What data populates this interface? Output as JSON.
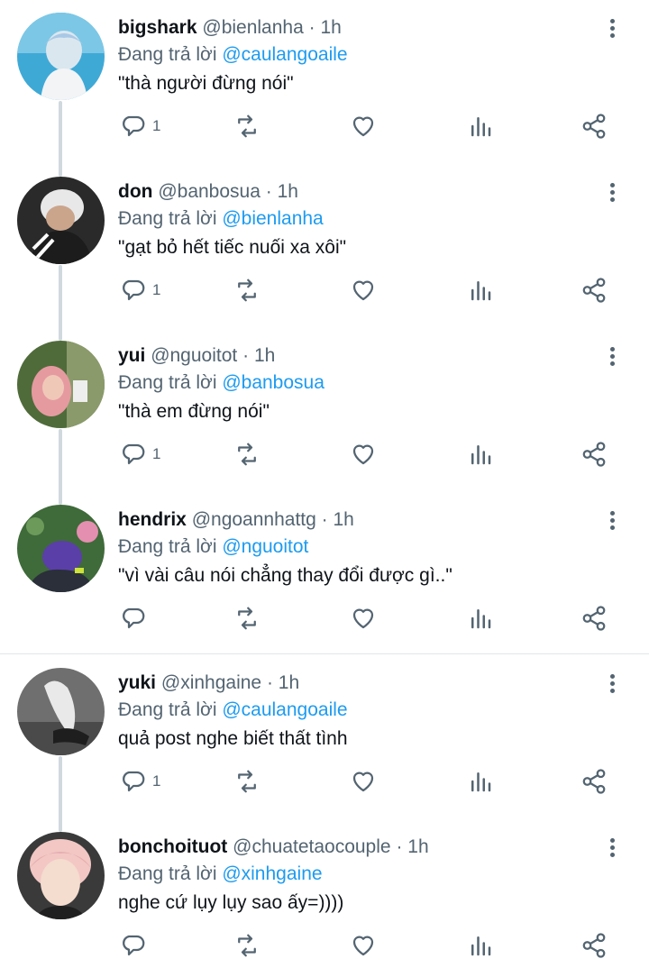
{
  "reply_prefix": "Đang trả lời",
  "tweets": [
    {
      "name": "bigshark",
      "handle": "@bienlanha",
      "dot": "·",
      "time": "1h",
      "mention": "@caulangoaile",
      "text": "\"thà người đừng nói\"",
      "reply_count": "1"
    },
    {
      "name": "don",
      "handle": "@banbosua",
      "dot": "·",
      "time": "1h",
      "mention": "@bienlanha",
      "text": "\"gạt bỏ hết tiếc nuối xa xôi\"",
      "reply_count": "1"
    },
    {
      "name": "yui",
      "handle": "@nguoitot",
      "dot": "·",
      "time": "1h",
      "mention": "@banbosua",
      "text": "\"thà em đừng nói\"",
      "reply_count": "1"
    },
    {
      "name": "hendrix",
      "handle": "@ngoannhattg",
      "dot": "·",
      "time": "1h",
      "mention": "@nguoitot",
      "text": "\"vì vài câu nói chẳng thay đổi được gì..\"",
      "reply_count": ""
    },
    {
      "name": "yuki",
      "handle": "@xinhgaine",
      "dot": "·",
      "time": "1h",
      "mention": "@caulangoaile",
      "text": "quả post nghe biết thất tình",
      "reply_count": "1"
    },
    {
      "name": "bonchoituot",
      "handle": "@chuatetaocouple",
      "dot": "·",
      "time": "1h",
      "mention": "@xinhgaine",
      "text": "nghe cứ lụy lụy sao ấy=))))",
      "reply_count": ""
    }
  ],
  "colors": {
    "accent": "#1d9bf0",
    "muted": "#536471",
    "thread_line": "#cfd9de"
  }
}
